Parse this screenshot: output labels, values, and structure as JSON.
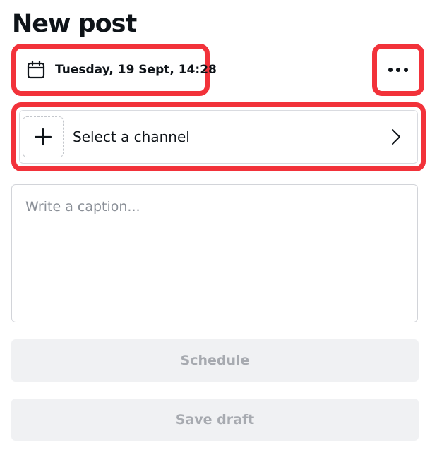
{
  "header": {
    "title": "New post"
  },
  "schedule_datetime": {
    "icon": "calendar-icon",
    "label": "Tuesday, 19 Sept, 14:28"
  },
  "more_menu": {
    "icon": "more-horizontal-icon"
  },
  "channel_selector": {
    "add_icon": "plus-icon",
    "label": "Select a channel",
    "chevron_icon": "chevron-right-icon"
  },
  "caption": {
    "value": "",
    "placeholder": "Write a caption..."
  },
  "actions": {
    "schedule_label": "Schedule",
    "save_draft_label": "Save draft"
  },
  "colors": {
    "highlight": "#f2323a",
    "text": "#0e1318",
    "disabled_bg": "#f0f1f3",
    "disabled_text": "#a7aab0"
  }
}
